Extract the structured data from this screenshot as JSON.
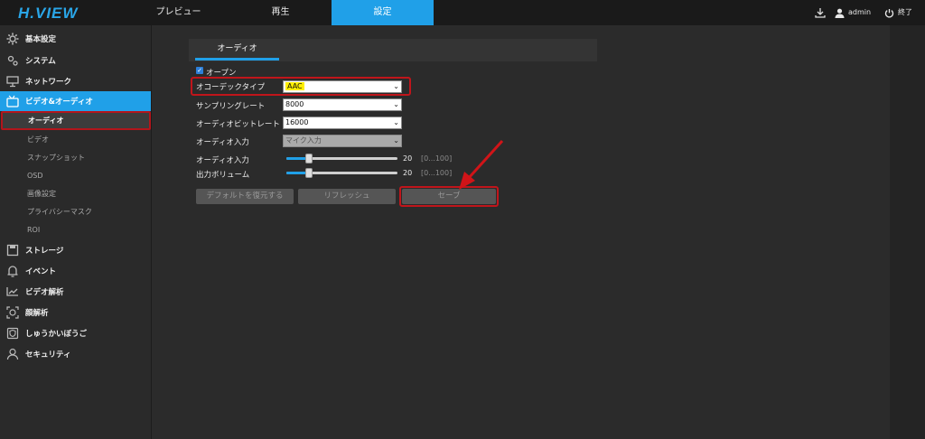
{
  "app": {
    "logo": "H.VIEW"
  },
  "nav": {
    "tabs": [
      {
        "label": "プレビュー"
      },
      {
        "label": "再生"
      },
      {
        "label": "設定"
      }
    ]
  },
  "topright": {
    "user": "admin",
    "logout": "終了"
  },
  "sidebar": {
    "items": [
      {
        "label": "基本設定",
        "icon": "gear-icon"
      },
      {
        "label": "システム",
        "icon": "gears-icon"
      },
      {
        "label": "ネットワーク",
        "icon": "network-icon"
      },
      {
        "label": "ビデオ&オーディオ",
        "icon": "video-audio-icon"
      },
      {
        "label": "ストレージ",
        "icon": "save-icon"
      },
      {
        "label": "イベント",
        "icon": "alarm-icon"
      },
      {
        "label": "ビデオ解析",
        "icon": "analysis-icon"
      },
      {
        "label": "顔解析",
        "icon": "face-icon"
      },
      {
        "label": "しゅうかいぼうご",
        "icon": "shield-icon"
      },
      {
        "label": "セキュリティ",
        "icon": "user-icon"
      }
    ],
    "subitems": [
      "オーディオ",
      "ビデオ",
      "スナップショット",
      "OSD",
      "画像設定",
      "プライバシーマスク",
      "ROI"
    ]
  },
  "page": {
    "tab": "オーディオ",
    "open_label": "オープン",
    "open_checked": true,
    "codec_label": "オコーデックタイプ",
    "codec_value": "AAC",
    "sampling_label": "サンプリングレート",
    "sampling_value": "8000",
    "bitrate_label": "オーディオビットレート",
    "bitrate_value": "16000",
    "input_label": "オーディオ入力",
    "input_value": "マイク入力",
    "input_vol_label": "オーディオ入力",
    "input_vol_value": "20",
    "input_vol_range": "[0...100]",
    "output_vol_label": "出力ボリューム",
    "output_vol_value": "20",
    "output_vol_range": "[0...100]",
    "input_vol_level": 0.2,
    "output_vol_level": 0.2
  },
  "buttons": {
    "default": "デフォルトを復元する",
    "refresh": "リフレッシュ",
    "save": "セーブ"
  },
  "colors": {
    "accent": "#20a0e8",
    "highlight": "#c0151b"
  }
}
